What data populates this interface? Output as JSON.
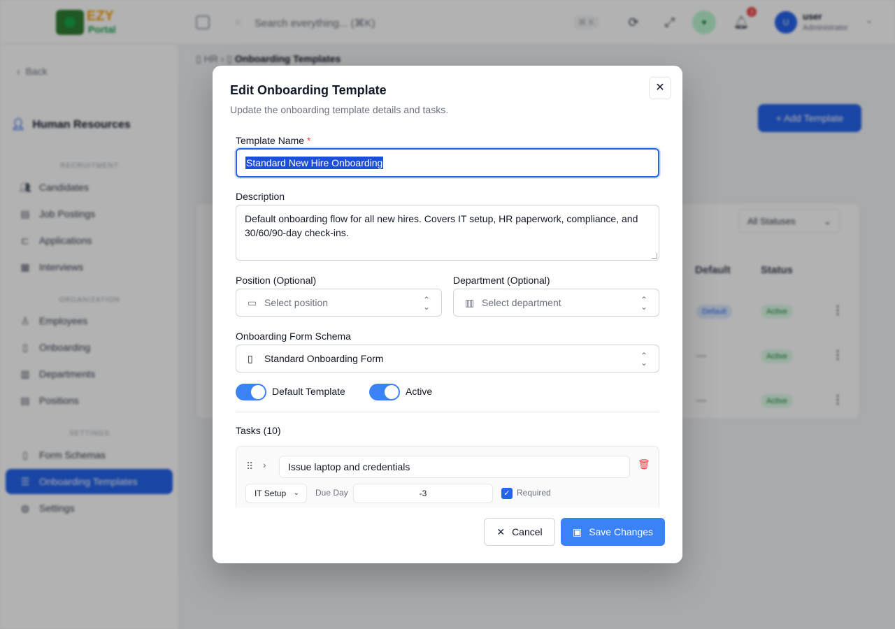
{
  "app": {
    "logo_text_top": "EZY",
    "logo_text_bottom": "Portal",
    "search_placeholder": "Search everything... (⌘K)",
    "search_shortcut": "⌘ K",
    "user_initial": "U",
    "user_name": "user",
    "user_role": "Administrator",
    "notification_count": "3",
    "status_avatar": "♥"
  },
  "sidebar": {
    "back_label": "Back",
    "module_title": "Human Resources",
    "sections": [
      {
        "label": "RECRUITMENT"
      },
      {
        "label": "ORGANIZATION"
      },
      {
        "label": "SETTINGS"
      }
    ],
    "items": [
      {
        "label": "Candidates",
        "icon": "users-icon"
      },
      {
        "label": "Job Postings",
        "icon": "briefcase-icon"
      },
      {
        "label": "Applications",
        "icon": "file-icon"
      },
      {
        "label": "Interviews",
        "icon": "calendar-icon"
      },
      {
        "label": "Employees",
        "icon": "user-plus-icon"
      },
      {
        "label": "Onboarding",
        "icon": "clipboard-icon"
      },
      {
        "label": "Departments",
        "icon": "building-icon"
      },
      {
        "label": "Positions",
        "icon": "briefcase-icon"
      },
      {
        "label": "Form Schemas",
        "icon": "document-icon"
      },
      {
        "label": "Onboarding Templates",
        "icon": "list-icon",
        "active": true
      },
      {
        "label": "Settings",
        "icon": "globe-icon"
      }
    ]
  },
  "page": {
    "breadcrumb_root": "HR",
    "breadcrumb_current": "Onboarding Templates",
    "add_button": "+ Add Template",
    "status_filter": "All Statuses",
    "columns": [
      "Default",
      "Status"
    ],
    "rows": [
      {
        "default": "Default",
        "status": "Active"
      },
      {
        "default": "—",
        "status": "Active"
      },
      {
        "default": "—",
        "status": "Active"
      }
    ]
  },
  "modal": {
    "title": "Edit Onboarding Template",
    "subtitle": "Update the onboarding template details and tasks.",
    "name_label": "Template Name",
    "required_mark": "*",
    "name_value": "Standard New Hire Onboarding",
    "description_label": "Description",
    "description_value": "Default onboarding flow for all new hires. Covers IT setup, HR paperwork, compliance, and 30/60/90-day check-ins.",
    "position_label": "Position (Optional)",
    "position_placeholder": "Select position",
    "department_label": "Department (Optional)",
    "department_placeholder": "Select department",
    "schema_label": "Onboarding Form Schema",
    "schema_value": "Standard Onboarding Form",
    "default_toggle_label": "Default Template",
    "default_toggle_on": true,
    "active_toggle_label": "Active",
    "active_toggle_on": true,
    "tasks_title": "Tasks (10)",
    "tasks": [
      {
        "name": "Issue laptop and credentials",
        "category": "IT Setup",
        "due_day_label": "Due Day",
        "due_day": "-3",
        "required_label": "Required",
        "required": true
      }
    ],
    "cancel_label": "Cancel",
    "save_label": "Save Changes"
  },
  "colors": {
    "accent": "#3b82f6",
    "danger": "#ef4444",
    "active_pill": "#dcfce7"
  }
}
